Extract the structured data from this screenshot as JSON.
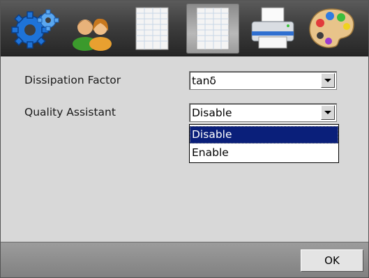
{
  "toolbar": {
    "icons": [
      "gear-icon",
      "users-icon",
      "document-icon",
      "document-icon",
      "printer-icon",
      "palette-icon"
    ],
    "selected_index": 3
  },
  "settings": {
    "dissipation_factor": {
      "label": "Dissipation Factor",
      "value": "tanδ"
    },
    "quality_assistant": {
      "label": "Quality Assistant",
      "value": "Disable",
      "options": [
        "Disable",
        "Enable"
      ],
      "highlighted": "Disable"
    }
  },
  "footer": {
    "ok_label": "OK"
  },
  "colors": {
    "highlight": "#0a1f7a",
    "toolbar_bg": "#3e3e3e"
  }
}
